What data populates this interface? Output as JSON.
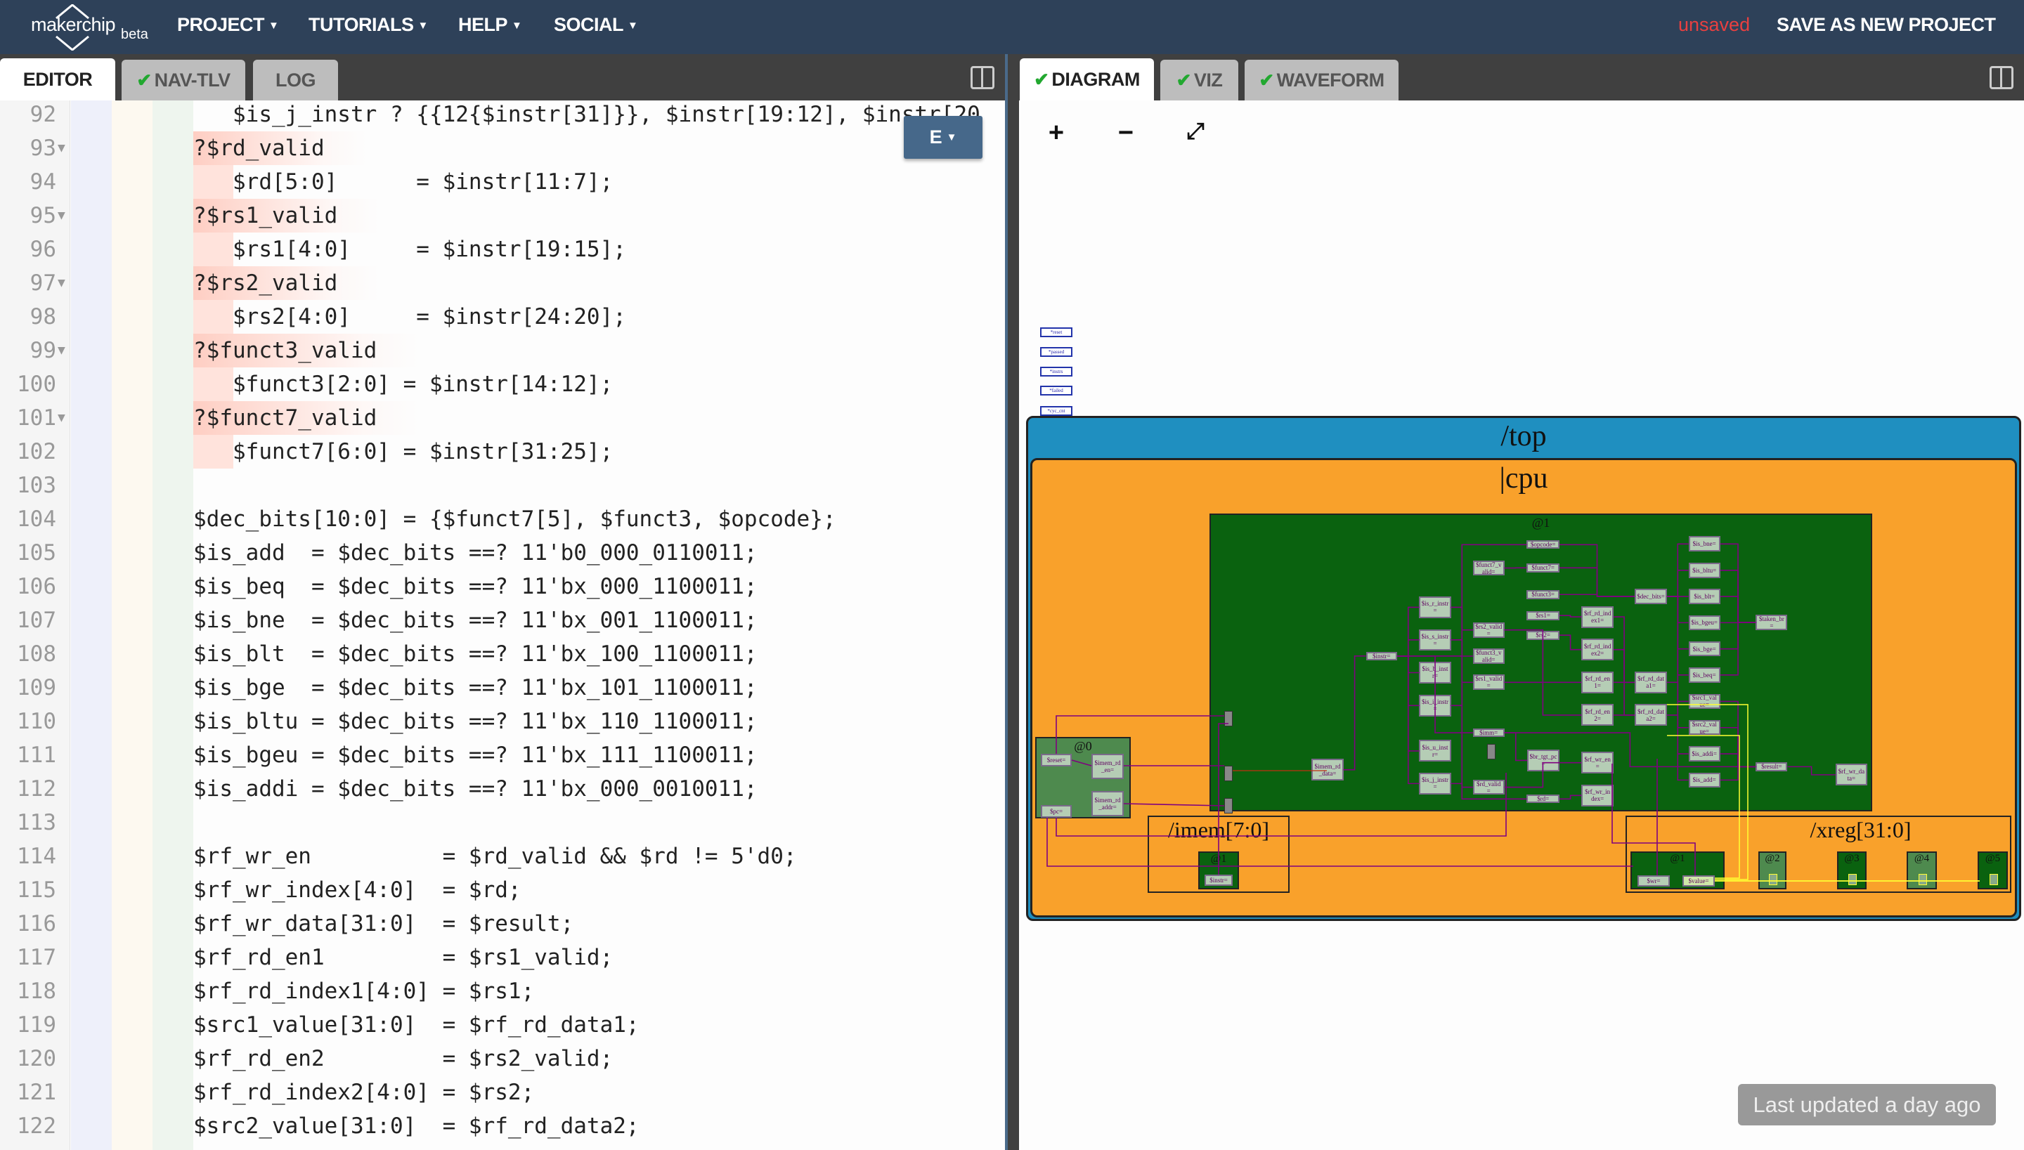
{
  "topbar": {
    "logo_text": "makerchip",
    "logo_badge": "beta",
    "menus": [
      {
        "label": "PROJECT"
      },
      {
        "label": "TUTORIALS"
      },
      {
        "label": "HELP"
      },
      {
        "label": "SOCIAL"
      }
    ],
    "status": "unsaved",
    "save_label": "SAVE AS NEW PROJECT",
    "colors": {
      "bar": "#2e4159",
      "status": "#e84040"
    }
  },
  "left_tabs": [
    {
      "label": "EDITOR",
      "active": true,
      "check": false
    },
    {
      "label": "NAV-TLV",
      "check": true
    },
    {
      "label": "LOG",
      "check": false
    }
  ],
  "right_tabs": [
    {
      "label": "DIAGRAM",
      "active": true,
      "check": true
    },
    {
      "label": "VIZ",
      "check": true
    },
    {
      "label": "WAVEFORM",
      "check": true
    }
  ],
  "editor": {
    "mode_button": "E",
    "first_line": 92,
    "lines": [
      "   $is_j_instr ? {{12{$instr[31]}}, $instr[19:12], $instr[20",
      "?$rd_valid",
      "   $rd[5:0]      = $instr[11:7];",
      "?$rs1_valid",
      "   $rs1[4:0]     = $instr[19:15];",
      "?$rs2_valid",
      "   $rs2[4:0]     = $instr[24:20];",
      "?$funct3_valid",
      "   $funct3[2:0] = $instr[14:12];",
      "?$funct7_valid",
      "   $funct7[6:0] = $instr[31:25];",
      "",
      "$dec_bits[10:0] = {$funct7[5], $funct3, $opcode};",
      "$is_add  = $dec_bits ==? 11'b0_000_0110011;",
      "$is_beq  = $dec_bits ==? 11'bx_000_1100011;",
      "$is_bne  = $dec_bits ==? 11'bx_001_1100011;",
      "$is_blt  = $dec_bits ==? 11'bx_100_1100011;",
      "$is_bge  = $dec_bits ==? 11'bx_101_1100011;",
      "$is_bltu = $dec_bits ==? 11'bx_110_1100011;",
      "$is_bgeu = $dec_bits ==? 11'bx_111_1100011;",
      "$is_addi = $dec_bits ==? 11'bx_000_0010011;",
      "",
      "$rf_wr_en          = $rd_valid && $rd != 5'd0;",
      "$rf_wr_index[4:0]  = $rd;",
      "$rf_wr_data[31:0]  = $result;",
      "$rf_rd_en1         = $rs1_valid;",
      "$rf_rd_index1[4:0] = $rs1;",
      "$src1_value[31:0]  = $rf_rd_data1;",
      "$rf_rd_en2         = $rs2_valid;",
      "$rf_rd_index2[4:0] = $rs2;",
      "$src2_value[31:0]  = $rf_rd_data2;",
      ""
    ],
    "foldable_lines": [
      93,
      95,
      97,
      99,
      101
    ]
  },
  "diagram": {
    "toolbar": {
      "zoom_in": "+",
      "zoom_out": "−",
      "fit": "⤢"
    },
    "signals": [
      "*reset",
      "*passed",
      "*instrs",
      "*failed",
      "*cyc_cnt"
    ],
    "top_scope": "/top",
    "pipeline": "|cpu",
    "stage_main": "@1",
    "stage_zero": "@0",
    "imem": {
      "label": "/imem[7:0]",
      "stage": "@1",
      "nodes": [
        "$instr="
      ]
    },
    "xreg": {
      "label": "/xreg[31:0]",
      "stages": [
        "@1",
        "@2",
        "@3",
        "@4",
        "@5"
      ],
      "nodes": [
        "$wr=",
        "$value="
      ]
    },
    "stage_zero_nodes": [
      "$reset=",
      "$imem_rd_en=",
      "$pc=",
      "$imem_rd_addr="
    ],
    "nodes": [
      "$opcode=",
      "$funct7_valid=",
      "$funct7=",
      "$funct3=",
      "$dec_bits=",
      "$is_bne=",
      "$is_bltu=",
      "$is_blt=",
      "$is_bgeu=",
      "$is_bge=",
      "$is_beq=",
      "$taken_br=",
      "$is_r_instr=",
      "$rs1=",
      "$rf_rd_index1=",
      "$rs2_valid=",
      "$is_s_instr=",
      "$rs2=",
      "$rf_rd_index2=",
      "$instr=",
      "$funct3_valid=",
      "$is_b_instr=",
      "$rs1_valid=",
      "$rf_rd_en1=",
      "$rf_rd_data1=",
      "$src1_value=",
      "$is_i_instr=",
      "$rf_rd_en2=",
      "$rf_rd_data2=",
      "$src2_value=",
      "$imm=",
      "$is_u_instr=",
      "$is_addi=",
      "$imem_rd_data=",
      "$br_tgt_pc=",
      "$rf_wr_en=",
      "$result=",
      "$rf_wr_data=",
      "$is_add=",
      "$is_j_instr=",
      "$rd_valid=",
      "$rd=",
      "$rf_wr_index="
    ],
    "colors": {
      "top": "#1f8fc0",
      "pipeline": "#f9a12b",
      "stage": "#0a620f",
      "stage_zero": "#4e8a4e",
      "node": "#b5cdb5",
      "wire": "#800080",
      "wire_highlight": "#ffff33"
    }
  },
  "status_badge": "Last updated a day ago"
}
